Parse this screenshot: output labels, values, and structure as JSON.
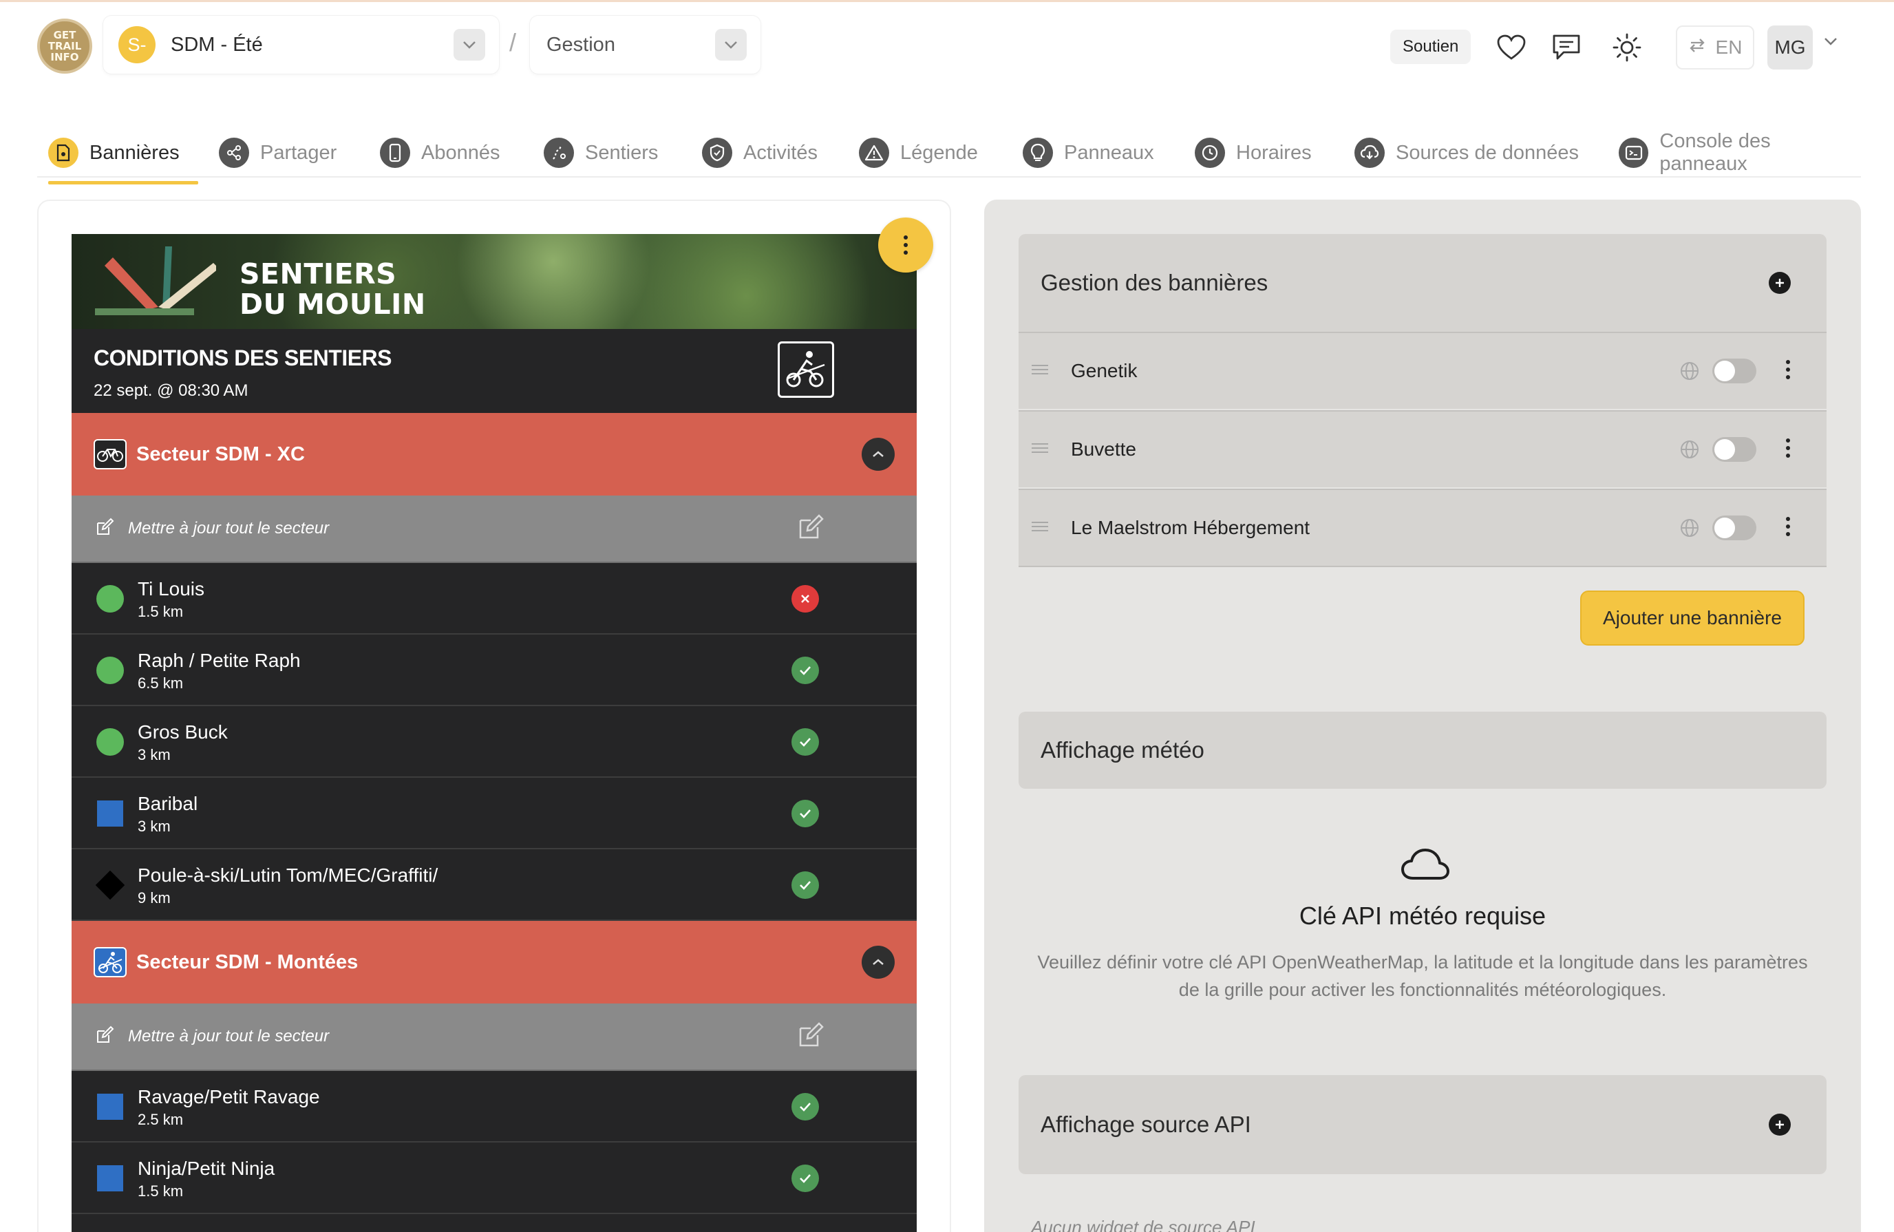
{
  "header": {
    "logo_text": [
      "GET",
      "TRAIL",
      "INFO"
    ],
    "project": {
      "avatar": "S-",
      "name": "SDM - Été"
    },
    "separator": "/",
    "mode": "Gestion",
    "support_label": "Soutien",
    "language": "EN",
    "user_initials": "MG"
  },
  "tabs": [
    {
      "label": "Bannières",
      "icon": "banner-icon",
      "active": true
    },
    {
      "label": "Partager",
      "icon": "share-icon"
    },
    {
      "label": "Abonnés",
      "icon": "phone-icon"
    },
    {
      "label": "Sentiers",
      "icon": "trail-icon"
    },
    {
      "label": "Activités",
      "icon": "activity-icon"
    },
    {
      "label": "Légende",
      "icon": "warning-icon"
    },
    {
      "label": "Panneaux",
      "icon": "lightbulb-icon"
    },
    {
      "label": "Horaires",
      "icon": "clock-icon"
    },
    {
      "label": "Sources de données",
      "icon": "cloud-download-icon"
    },
    {
      "label": "Console des panneaux",
      "icon": "terminal-icon"
    }
  ],
  "preview": {
    "banner_title_line1": "SENTIERS",
    "banner_title_line2": "DU MOULIN",
    "conditions_title": "CONDITIONS DES SENTIERS",
    "conditions_date": "22 sept. @ 08:30 AM",
    "sectors": [
      {
        "name": "Secteur SDM - XC",
        "update_label": "Mettre à jour tout le secteur",
        "trails": [
          {
            "name": "Ti Louis",
            "length": "1.5 km",
            "difficulty": "green-circle",
            "status": "closed"
          },
          {
            "name": "Raph / Petite Raph",
            "length": "6.5 km",
            "difficulty": "green-circle",
            "status": "open"
          },
          {
            "name": "Gros Buck",
            "length": "3 km",
            "difficulty": "green-circle",
            "status": "open"
          },
          {
            "name": "Baribal",
            "length": "3 km",
            "difficulty": "blue-square",
            "status": "open"
          },
          {
            "name": "Poule-à-ski/Lutin Tom/MEC/Graffiti/",
            "length": "9 km",
            "difficulty": "black-diamond",
            "status": "open"
          }
        ]
      },
      {
        "name": "Secteur SDM - Montées",
        "update_label": "Mettre à jour tout le secteur",
        "trails": [
          {
            "name": "Ravage/Petit Ravage",
            "length": "2.5 km",
            "difficulty": "blue-square",
            "status": "open"
          },
          {
            "name": "Ninja/Petit Ninja",
            "length": "1.5 km",
            "difficulty": "blue-square",
            "status": "open"
          }
        ]
      }
    ]
  },
  "banners_section": {
    "title": "Gestion des bannières",
    "items": [
      {
        "name": "Genetik",
        "enabled": false
      },
      {
        "name": "Buvette",
        "enabled": false
      },
      {
        "name": "Le Maelstrom Hébergement",
        "enabled": false
      }
    ],
    "add_label": "Ajouter une bannière"
  },
  "weather_section": {
    "title": "Affichage météo",
    "empty_title": "Clé API météo requise",
    "empty_desc": "Veuillez définir votre clé API OpenWeatherMap, la latitude et la longitude dans les paramètres de la grille pour activer les fonctionnalités météorologiques."
  },
  "api_section": {
    "title": "Affichage source API",
    "empty_text": "Aucun widget de source API"
  },
  "colors": {
    "accent": "#f4c542",
    "sector_red": "#d56050",
    "panel_dark": "#252526",
    "status_open": "#4f9a57",
    "status_closed": "#e03b3b"
  }
}
